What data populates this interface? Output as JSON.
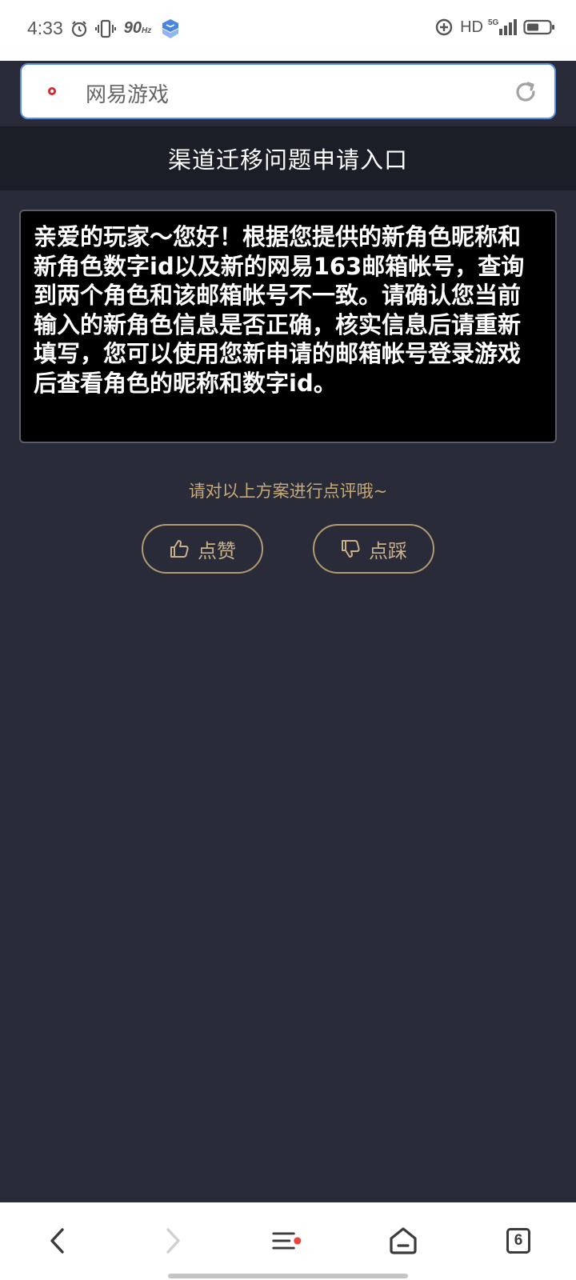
{
  "status_bar": {
    "time": "4:33",
    "refresh_rate": "90",
    "refresh_unit": "Hz",
    "network_quality": "HD",
    "network_type": "5G",
    "icons": [
      "alarm-icon",
      "vibrate-icon",
      "app-notification-icon",
      "data-saver-icon",
      "signal-icon",
      "battery-icon"
    ]
  },
  "browser": {
    "address_text": "网易游戏",
    "tab_count": "6",
    "accent_color": "#5b8ee6"
  },
  "page": {
    "title": "渠道迁移问题申请入口",
    "message": "亲爱的玩家～您好！根据您提供的新角色昵称和新角色数字id以及新的网易163邮箱帐号，查询到两个角色和该邮箱帐号不一致。请确认您当前输入的新角色信息是否正确，核实信息后请重新填写，您可以使用您新申请的邮箱帐号登录游戏后查看角色的昵称和数字id。",
    "feedback_prompt": "请对以上方案进行点评哦~",
    "like_label": "点赞",
    "dislike_label": "点踩"
  },
  "colors": {
    "background": "#292c38",
    "header_background": "#1c1e27",
    "gold_text": "#c8a978"
  }
}
